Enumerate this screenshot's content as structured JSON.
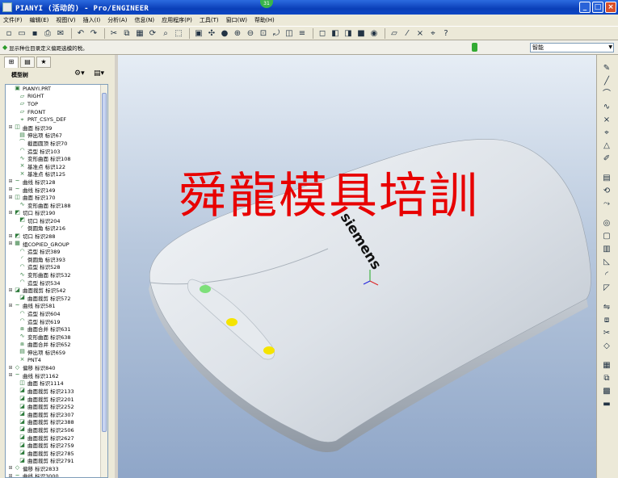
{
  "window": {
    "title": "PIANYI (活动的) - Pro/ENGINEER",
    "notification_badge": "31"
  },
  "menu": [
    "文件(F)",
    "编辑(E)",
    "视图(V)",
    "插入(I)",
    "分析(A)",
    "信息(N)",
    "应用程序(P)",
    "工具(T)",
    "窗口(W)",
    "帮助(H)"
  ],
  "toolbar_icons": [
    "new-icon",
    "open-icon",
    "save-icon",
    "print-icon",
    "email-icon",
    "separator",
    "undo-icon",
    "redo-icon",
    "separator",
    "cut-icon",
    "copy-icon",
    "paste-icon",
    "regenerate-icon",
    "find-icon",
    "select-box-icon",
    "separator",
    "repaint-icon",
    "spin-center-icon",
    "orient-icon",
    "zoom-in-icon",
    "zoom-out-icon",
    "refit-icon",
    "reorient-icon",
    "saved-views-icon",
    "layers-icon",
    "separator",
    "wireframe-icon",
    "hidden-line-icon",
    "no-hidden-icon",
    "shading-icon",
    "appearance-icon",
    "separator",
    "datum-planes-icon",
    "datum-axes-icon",
    "datum-points-icon",
    "csys-icon",
    "help-icon"
  ],
  "messages": {
    "prompt": "显示种位目录定义偏距选模的税。",
    "filter": "智能"
  },
  "model_tree": {
    "header": "模型树",
    "items": [
      {
        "label": "PIANYI.PRT",
        "icon": "part",
        "expandable": false,
        "indent": 0
      },
      {
        "label": "RIGHT",
        "icon": "plane",
        "expandable": false,
        "indent": 1
      },
      {
        "label": "TOP",
        "icon": "plane",
        "expandable": false,
        "indent": 1
      },
      {
        "label": "FRONT",
        "icon": "plane",
        "expandable": false,
        "indent": 1
      },
      {
        "label": "PRT_CSYS_DEF",
        "icon": "csys",
        "expandable": false,
        "indent": 1
      },
      {
        "label": "曲面 标识39",
        "icon": "surface",
        "expandable": true,
        "indent": 0
      },
      {
        "label": "伸出项 标识67",
        "icon": "extrude",
        "expandable": false,
        "indent": 1
      },
      {
        "label": "截面圆顶 标识70",
        "icon": "dome",
        "expandable": false,
        "indent": 1
      },
      {
        "label": "造型 标识103",
        "icon": "style",
        "expandable": false,
        "indent": 1
      },
      {
        "label": "变形曲面 标识108",
        "icon": "warp",
        "expandable": false,
        "indent": 1
      },
      {
        "label": "基准点 标识122",
        "icon": "point",
        "expandable": false,
        "indent": 1
      },
      {
        "label": "基准点 标识125",
        "icon": "point",
        "expandable": false,
        "indent": 1
      },
      {
        "label": "曲线 标识128",
        "icon": "curve",
        "expandable": true,
        "indent": 0
      },
      {
        "label": "曲线 标识149",
        "icon": "curve",
        "expandable": true,
        "indent": 0
      },
      {
        "label": "曲面 标识170",
        "icon": "surface",
        "expandable": true,
        "indent": 0
      },
      {
        "label": "变形曲面 标识188",
        "icon": "warp",
        "expandable": false,
        "indent": 1
      },
      {
        "label": "切口 标识190",
        "icon": "cut",
        "expandable": true,
        "indent": 0
      },
      {
        "label": "切口 标识204",
        "icon": "cut",
        "expandable": false,
        "indent": 1
      },
      {
        "label": "倒圆角 标识216",
        "icon": "round",
        "expandable": false,
        "indent": 1
      },
      {
        "label": "切口 标识288",
        "icon": "cut",
        "expandable": true,
        "indent": 0
      },
      {
        "label": "组COPIED_GROUP",
        "icon": "group",
        "expandable": true,
        "indent": 0
      },
      {
        "label": "造型 标识389",
        "icon": "style",
        "expandable": false,
        "indent": 1
      },
      {
        "label": "倒圆角 标识393",
        "icon": "round",
        "expandable": false,
        "indent": 1
      },
      {
        "label": "造型 标识528",
        "icon": "style",
        "expandable": false,
        "indent": 1
      },
      {
        "label": "变形曲面 标识532",
        "icon": "warp",
        "expandable": false,
        "indent": 1
      },
      {
        "label": "造型 标识534",
        "icon": "style",
        "expandable": false,
        "indent": 1
      },
      {
        "label": "曲面裁剪 标识542",
        "icon": "trim",
        "expandable": true,
        "indent": 0
      },
      {
        "label": "曲面裁剪 标识572",
        "icon": "trim",
        "expandable": false,
        "indent": 1
      },
      {
        "label": "曲线 标识581",
        "icon": "curve",
        "expandable": true,
        "indent": 0
      },
      {
        "label": "造型 标识604",
        "icon": "style",
        "expandable": false,
        "indent": 1
      },
      {
        "label": "造型 标识619",
        "icon": "style",
        "expandable": false,
        "indent": 1
      },
      {
        "label": "曲面合并 标识631",
        "icon": "merge",
        "expandable": false,
        "indent": 1
      },
      {
        "label": "变形曲面 标识638",
        "icon": "warp",
        "expandable": false,
        "indent": 1
      },
      {
        "label": "曲面合并 标识652",
        "icon": "merge",
        "expandable": false,
        "indent": 1
      },
      {
        "label": "伸出项 标识659",
        "icon": "extrude",
        "expandable": false,
        "indent": 1
      },
      {
        "label": "PNT4",
        "icon": "point",
        "expandable": false,
        "indent": 1
      },
      {
        "label": "偏移 标识840",
        "icon": "offset",
        "expandable": true,
        "indent": 0
      },
      {
        "label": "曲线 标识1162",
        "icon": "curve",
        "expandable": true,
        "indent": 0
      },
      {
        "label": "曲面 标识1114",
        "icon": "surface",
        "expandable": false,
        "indent": 1
      },
      {
        "label": "曲面裁剪 标识2133",
        "icon": "trim",
        "expandable": false,
        "indent": 1
      },
      {
        "label": "曲面裁剪 标识2201",
        "icon": "trim",
        "expandable": false,
        "indent": 1
      },
      {
        "label": "曲面裁剪 标识2252",
        "icon": "trim",
        "expandable": false,
        "indent": 1
      },
      {
        "label": "曲面裁剪 标识2307",
        "icon": "trim",
        "expandable": false,
        "indent": 1
      },
      {
        "label": "曲面裁剪 标识2388",
        "icon": "trim",
        "expandable": false,
        "indent": 1
      },
      {
        "label": "曲面裁剪 标识2506",
        "icon": "trim",
        "expandable": false,
        "indent": 1
      },
      {
        "label": "曲面裁剪 标识2627",
        "icon": "trim",
        "expandable": false,
        "indent": 1
      },
      {
        "label": "曲面裁剪 标识2759",
        "icon": "trim",
        "expandable": false,
        "indent": 1
      },
      {
        "label": "曲面裁剪 标识2785",
        "icon": "trim",
        "expandable": false,
        "indent": 1
      },
      {
        "label": "曲面裁剪 标识2791",
        "icon": "trim",
        "expandable": false,
        "indent": 1
      },
      {
        "label": "偏移 标识2833",
        "icon": "offset",
        "expandable": true,
        "indent": 0
      },
      {
        "label": "曲线 标识3000",
        "icon": "curve",
        "expandable": true,
        "indent": 0
      }
    ]
  },
  "viewport": {
    "watermark": "舜龍模具培訓",
    "logo_text": "siemens",
    "led_colors": [
      "#7ee07a",
      "#f5e400",
      "#f5e400"
    ]
  },
  "right_toolbar_icons": [
    "sketch-icon",
    "line-icon",
    "arc-icon",
    "spline-icon",
    "point-datum-icon",
    "csys-datum-icon",
    "analysis-icon",
    "edit-icon",
    "separator",
    "extrude-tool-icon",
    "revolve-tool-icon",
    "sweep-tool-icon",
    "separator",
    "hole-icon",
    "shell-icon",
    "rib-icon",
    "draft-icon",
    "round-icon",
    "chamfer-icon",
    "separator",
    "mirror-icon",
    "merge-icon",
    "trim-icon",
    "offset-icon",
    "separator",
    "pattern-icon",
    "copy-tool-icon",
    "fill-icon",
    "thicken-icon"
  ]
}
